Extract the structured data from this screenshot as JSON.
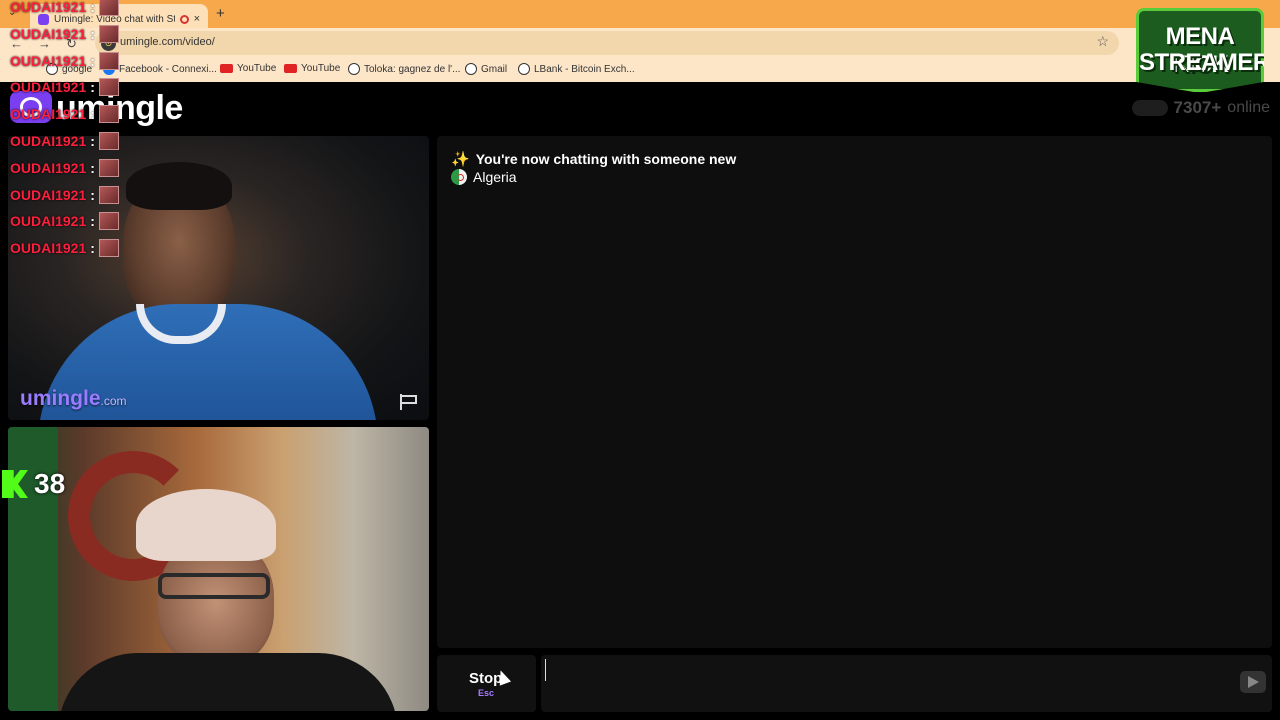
{
  "browser": {
    "tab": {
      "title": "Umingle: Video chat with St",
      "close": "×"
    },
    "tab_menu": "⌄",
    "new_tab": "+",
    "address": {
      "url": "umingle.com/video/",
      "site_icon_glyph": "⊙"
    },
    "nav": {
      "back": "←",
      "forward": "→",
      "reload": "↻"
    },
    "bookmark_star": "☆",
    "bookmarks": [
      {
        "label": "google",
        "icon": "globe-icon"
      },
      {
        "label": "Facebook - Connexi...",
        "icon": "facebook-icon"
      },
      {
        "label": "YouTube",
        "icon": "youtube-icon"
      },
      {
        "label": "YouTube",
        "icon": "youtube-icon"
      },
      {
        "label": "Toloka: gagnez de l'...",
        "icon": "globe-icon"
      },
      {
        "label": "Gmail",
        "icon": "globe-icon"
      },
      {
        "label": "LBank - Bitcoin Exch...",
        "icon": "globe-icon"
      }
    ]
  },
  "app": {
    "logo_text": "umingle",
    "online_count": "7307+",
    "online_label": "online",
    "watermark": {
      "brand": "umingle",
      "tld": ".com"
    },
    "chat": {
      "system_message": "You're now chatting with someone new",
      "sparkle": "✨",
      "country": "Algeria"
    },
    "stop_button": {
      "label": "Stop",
      "shortcut": "Esc"
    },
    "message_input": {
      "value": "",
      "placeholder": ""
    }
  },
  "stream_overlay": {
    "chat_username": "OUDAI1921",
    "chat_separator": ":",
    "chat_line_count": 10,
    "kick_viewers": "38",
    "channel_logo": {
      "line1": "MENA KICK",
      "line2": "STREAMERS"
    }
  },
  "colors": {
    "accent": "#7a3ff0",
    "chat_name": "#ff1f3d",
    "kick_green": "#53fc18",
    "browser_tabbar": "#f6a84a"
  }
}
